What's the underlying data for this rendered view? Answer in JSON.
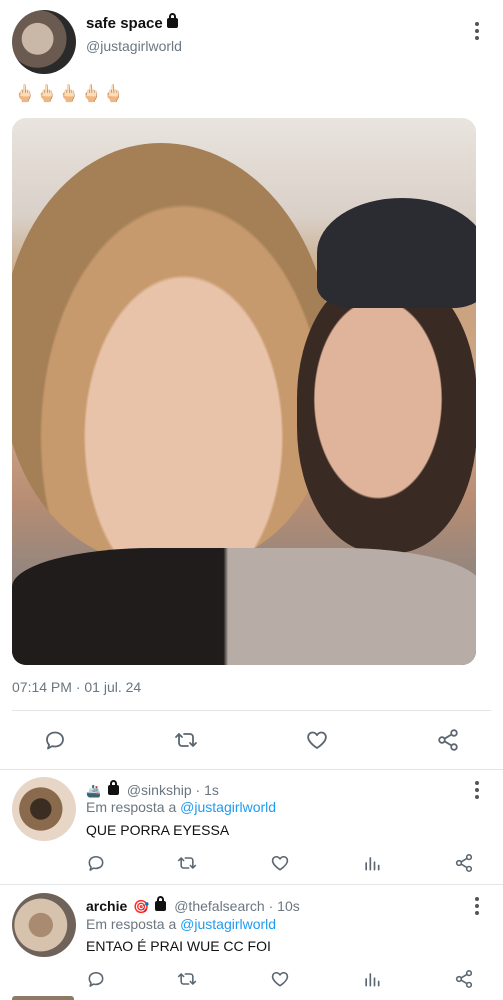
{
  "post": {
    "display_name": "safe space",
    "handle": "@justagirlworld",
    "emoji_text": "🖕🏻🖕🏻🖕🏻🖕🏻🖕🏻",
    "timestamp": "07:14 PM · 01 jul. 24"
  },
  "replies": [
    {
      "name_prefix": "🚢",
      "handle": "@sinkship",
      "age": "1s",
      "reply_label": "Em resposta a ",
      "reply_handle": "@justagirlworld",
      "text": "QUE PORRA EYESSA"
    },
    {
      "display_name": "archie",
      "name_emoji": "🎯",
      "handle": "@thefalsearch",
      "age": "10s",
      "reply_label": "Em resposta a ",
      "reply_handle": "@justagirlworld",
      "text": "ENTAO É PRAI WUE CC FOI"
    }
  ],
  "icons": {
    "reply": "reply-icon",
    "retweet": "retweet-icon",
    "like": "heart-icon",
    "share": "share-icon",
    "stats": "stats-icon",
    "more": "more-vertical-icon"
  },
  "colors": {
    "link": "#1d9bf0",
    "muted": "#6b7680",
    "icon": "#5b6670"
  }
}
